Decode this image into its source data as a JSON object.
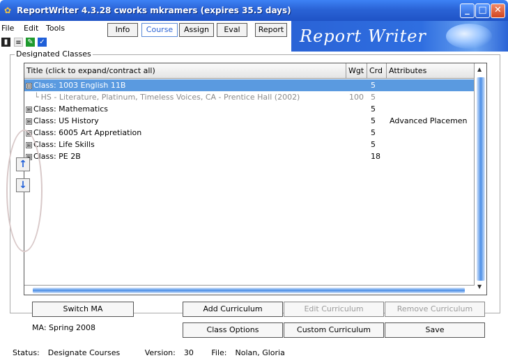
{
  "window": {
    "title": "ReportWriter 4.3.28  cworks mkramers (expires 35.5 days)",
    "app_icon": "rainbow-app-icon",
    "controls": [
      "minimize",
      "maximize",
      "close"
    ]
  },
  "menu": {
    "items": [
      "File",
      "Edit",
      "Tools"
    ]
  },
  "nav_tabs": [
    {
      "label": "Info",
      "active": false
    },
    {
      "label": "Course",
      "active": true
    },
    {
      "label": "Assign",
      "active": false
    },
    {
      "label": "Eval",
      "active": false
    },
    {
      "label": "Report",
      "active": false
    }
  ],
  "banner": {
    "text": "Report Writer"
  },
  "group": {
    "label": "Designated Classes"
  },
  "table": {
    "columns": [
      "Title (click to expand/contract all)",
      "Wgt",
      "Crd",
      "Attributes"
    ],
    "rows": [
      {
        "title": "Class: 1003 English 11B",
        "wgt": "",
        "crd": "5",
        "attributes": "",
        "expander": "⊟",
        "selected": true,
        "child": false
      },
      {
        "title": "HS - Literature, Platinum, Timeless Voices, CA - Prentice Hall (2002)",
        "wgt": "100",
        "crd": "5",
        "attributes": "",
        "expander": "",
        "selected": false,
        "child": true
      },
      {
        "title": "Class: Mathematics",
        "wgt": "",
        "crd": "5",
        "attributes": "",
        "expander": "⊞",
        "selected": false,
        "child": false
      },
      {
        "title": "Class: US History",
        "wgt": "",
        "crd": "5",
        "attributes": "Advanced Placemen",
        "expander": "⊞",
        "selected": false,
        "child": false
      },
      {
        "title": "Class: 6005 Art Appretiation",
        "wgt": "",
        "crd": "5",
        "attributes": "",
        "expander": "⊞",
        "selected": false,
        "child": false
      },
      {
        "title": "Class: Life Skills",
        "wgt": "",
        "crd": "5",
        "attributes": "",
        "expander": "⊞",
        "selected": false,
        "child": false
      },
      {
        "title": "Class: PE 2B",
        "wgt": "",
        "crd": "18",
        "attributes": "",
        "expander": "⊞",
        "selected": false,
        "child": false
      }
    ]
  },
  "side_buttons": {
    "up": "↑",
    "down": "↓"
  },
  "buttons": {
    "switch_ma": "Switch MA",
    "add_curriculum": "Add Curriculum",
    "edit_curriculum": "Edit Curriculum",
    "remove_curriculum": "Remove Curriculum",
    "class_options": "Class Options",
    "custom_curriculum": "Custom Curriculum",
    "save": "Save"
  },
  "ma_label": "MA: Spring 2008",
  "status": {
    "status_label": "Status:",
    "status_value": "Designate Courses",
    "version_label": "Version:",
    "version_value": "30",
    "file_label": "File:",
    "file_value": "Nolan, Gloria"
  },
  "colors": {
    "titlebar": "#2a63d6",
    "selection": "#5a9ae0",
    "active_tab_text": "#2a63d6"
  }
}
